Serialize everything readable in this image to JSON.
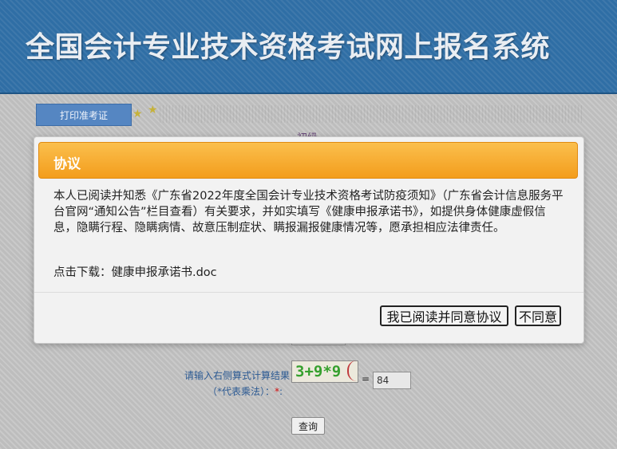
{
  "header": {
    "title": "全国会计专业技术资格考试网上报名系统"
  },
  "tabs": {
    "print_admission_label": "打印准考证"
  },
  "background": {
    "partial_text": "初级"
  },
  "modal": {
    "title": "协议",
    "body": "本人已阅读并知悉《广东省2022年度全国会计专业技术资格考试防疫须知》（广东省会计信息服务平台官网“通知公告”栏目查看）有关要求，并如实填写《健康申报承诺书》，如提供身体健康虚假信息，隐瞒行程、隐瞒病情、故意压制症状、瞒报漏报健康情况等，愿承担相应法律责任。",
    "download_text": "点击下载：健康申报承诺书.doc",
    "agree_label": "我已阅读并同意协议",
    "disagree_label": "不同意"
  },
  "captcha": {
    "label": "请输入右侧算式计算结果",
    "note": "（*代表乘法）：",
    "required_mark": "*",
    "colon": ":",
    "expression": "3+9*9",
    "equals": "=",
    "input_value": "84"
  },
  "query": {
    "label": "查询"
  },
  "colors": {
    "header_bg": "#2f6ea5",
    "modal_header": "#f7a82c",
    "tab_bg": "#5586c2",
    "captcha_text": "#36a02e",
    "required": "#d01010"
  },
  "icons": [
    "star-icon",
    "star-icon"
  ]
}
